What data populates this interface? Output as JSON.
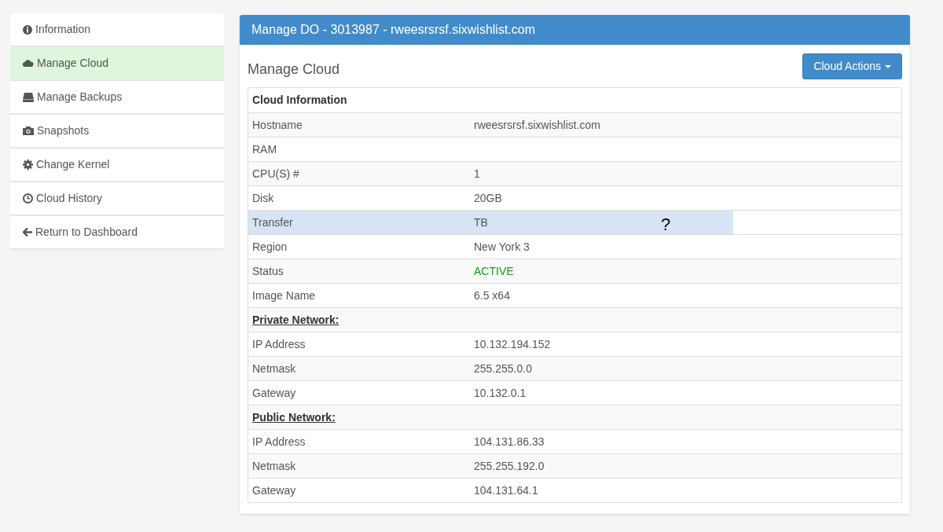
{
  "sidebar": {
    "items": [
      {
        "label": "Information",
        "selected": false
      },
      {
        "label": "Manage Cloud",
        "selected": true
      },
      {
        "label": "Manage Backups",
        "selected": false
      },
      {
        "label": "Snapshots",
        "selected": false
      },
      {
        "label": "Change Kernel",
        "selected": false
      },
      {
        "label": "Cloud History",
        "selected": false
      },
      {
        "label": "Return to Dashboard",
        "selected": false
      }
    ]
  },
  "panel": {
    "title": "Manage DO - 3013987 - rweesrsrsf.sixwishlist.com",
    "heading": "Manage Cloud",
    "action_button": "Cloud Actions"
  },
  "table": {
    "rows": [
      {
        "kind": "title",
        "label": "Cloud Information"
      },
      {
        "kind": "field",
        "label": "Hostname",
        "value": "rweesrsrsf.sixwishlist.com",
        "selected": false
      },
      {
        "kind": "field",
        "label": "RAM",
        "value": "",
        "selected": false
      },
      {
        "kind": "field",
        "label": "CPU(S) #",
        "value": "1",
        "selected": false
      },
      {
        "kind": "field",
        "label": "Disk",
        "value": "20GB",
        "selected": false
      },
      {
        "kind": "field",
        "label": "Transfer",
        "value": "TB",
        "note": "?",
        "selected": true
      },
      {
        "kind": "field",
        "label": "Region",
        "value": "New York 3",
        "selected": false
      },
      {
        "kind": "status",
        "label": "Status",
        "value": "ACTIVE",
        "selected": false
      },
      {
        "kind": "field",
        "label": "Image Name",
        "value": "6.5 x64",
        "selected": false
      },
      {
        "kind": "section",
        "label": "Private Network:"
      },
      {
        "kind": "field",
        "label": "IP Address",
        "value": "10.132.194.152",
        "selected": false
      },
      {
        "kind": "field",
        "label": "Netmask",
        "value": "255.255.0.0",
        "selected": false
      },
      {
        "kind": "field",
        "label": "Gateway",
        "value": "10.132.0.1",
        "selected": false
      },
      {
        "kind": "section",
        "label": "Public Network:"
      },
      {
        "kind": "field",
        "label": "IP Address",
        "value": "104.131.86.33",
        "selected": false
      },
      {
        "kind": "field",
        "label": "Netmask",
        "value": "255.255.192.0",
        "selected": false
      },
      {
        "kind": "field",
        "label": "Gateway",
        "value": "104.131.64.1",
        "selected": false
      }
    ]
  }
}
